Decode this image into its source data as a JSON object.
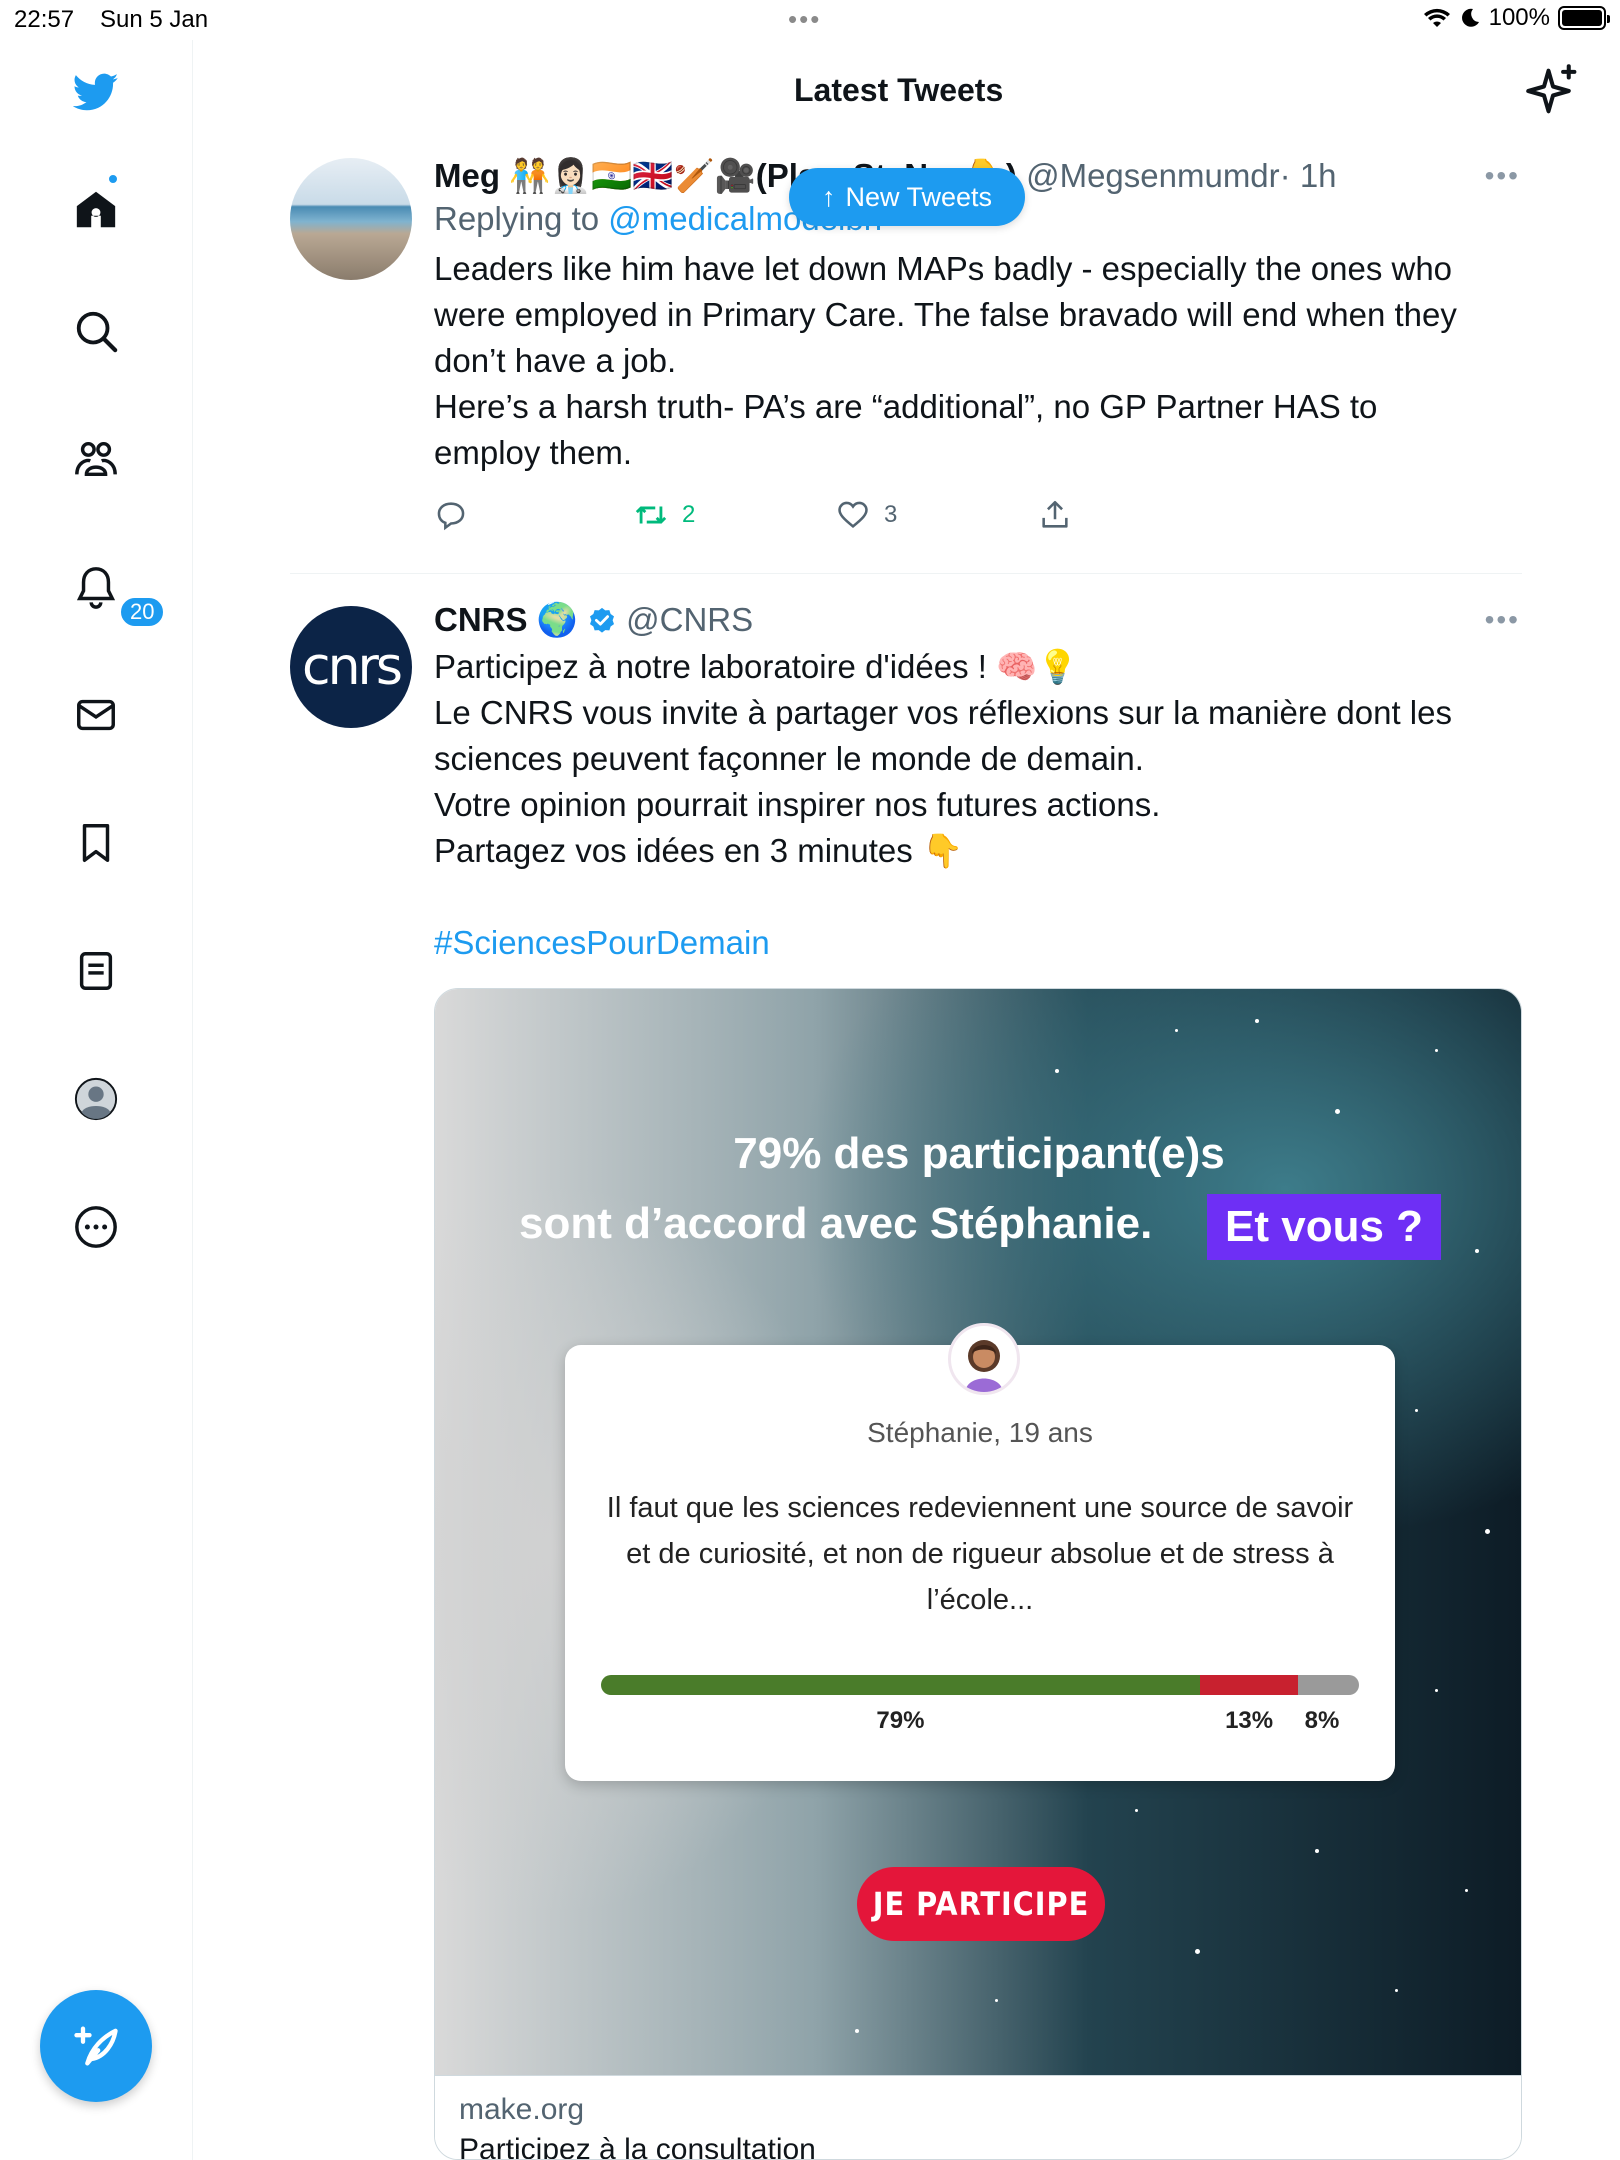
{
  "status_bar": {
    "time": "22:57",
    "date": "Sun 5 Jan",
    "battery": "100%"
  },
  "header": {
    "title": "Latest Tweets"
  },
  "sidebar": {
    "notification_count": "20"
  },
  "new_tweets_pill": {
    "label": "New Tweets"
  },
  "tweets": [
    {
      "name": "Meg 🧑‍🤝‍🧑👩🏻‍⚕️🇮🇳🇬🇧🏏🎥(PlaceStaNe",
      "name_tail": "e👇)",
      "handle": "@Megsenmumdr",
      "time": "· 1h",
      "replying_prefix": "Replying to",
      "replying_to": "@medicalmodelbh",
      "text": "Leaders like him have let down MAPs badly - especially the ones who\nwere employed in Primary Care. The false bravado will end when they\ndon’t have a job.\nHere’s a harsh truth- PA’s are “additional”, no GP Partner HAS to\nemploy them.",
      "retweets": "2",
      "likes": "3"
    },
    {
      "name": "CNRS 🌍",
      "handle": "@CNRS",
      "avatar_text": "cnrs",
      "text": "Participez à notre laboratoire d'idées ! 🧠💡\nLe CNRS vous invite à partager vos réflexions sur la manière dont les\nsciences peuvent façonner le monde de demain.\nVotre opinion pourrait inspirer nos futures actions.\nPartagez vos idées en 3 minutes 👇",
      "hashtag": "#SciencesPourDemain",
      "card": {
        "headline_line1": "79% des participant(e)s",
        "headline_line2": "sont d’accord avec Stéphanie.",
        "highlight": "Et vous ?",
        "persona": "Stéphanie, 19 ans",
        "quote": "Il faut que les sciences redeviennent une source de savoir et de curiosité, et non de rigueur absolue et de stress à l’école...",
        "poll": [
          {
            "label": "79%",
            "value": 79,
            "color": "#4a7c2a"
          },
          {
            "label": "13%",
            "value": 13,
            "color": "#c8212f"
          },
          {
            "label": "8%",
            "value": 8,
            "color": "#9a9a9a"
          }
        ],
        "cta": "JE PARTICIPE",
        "domain": "make.org",
        "title": "Participez à la consultation"
      }
    }
  ],
  "colors": {
    "accent": "#1d9bf0",
    "retweet": "#00ba7c",
    "cta": "#e4163a",
    "highlight": "#6e2ff5"
  }
}
